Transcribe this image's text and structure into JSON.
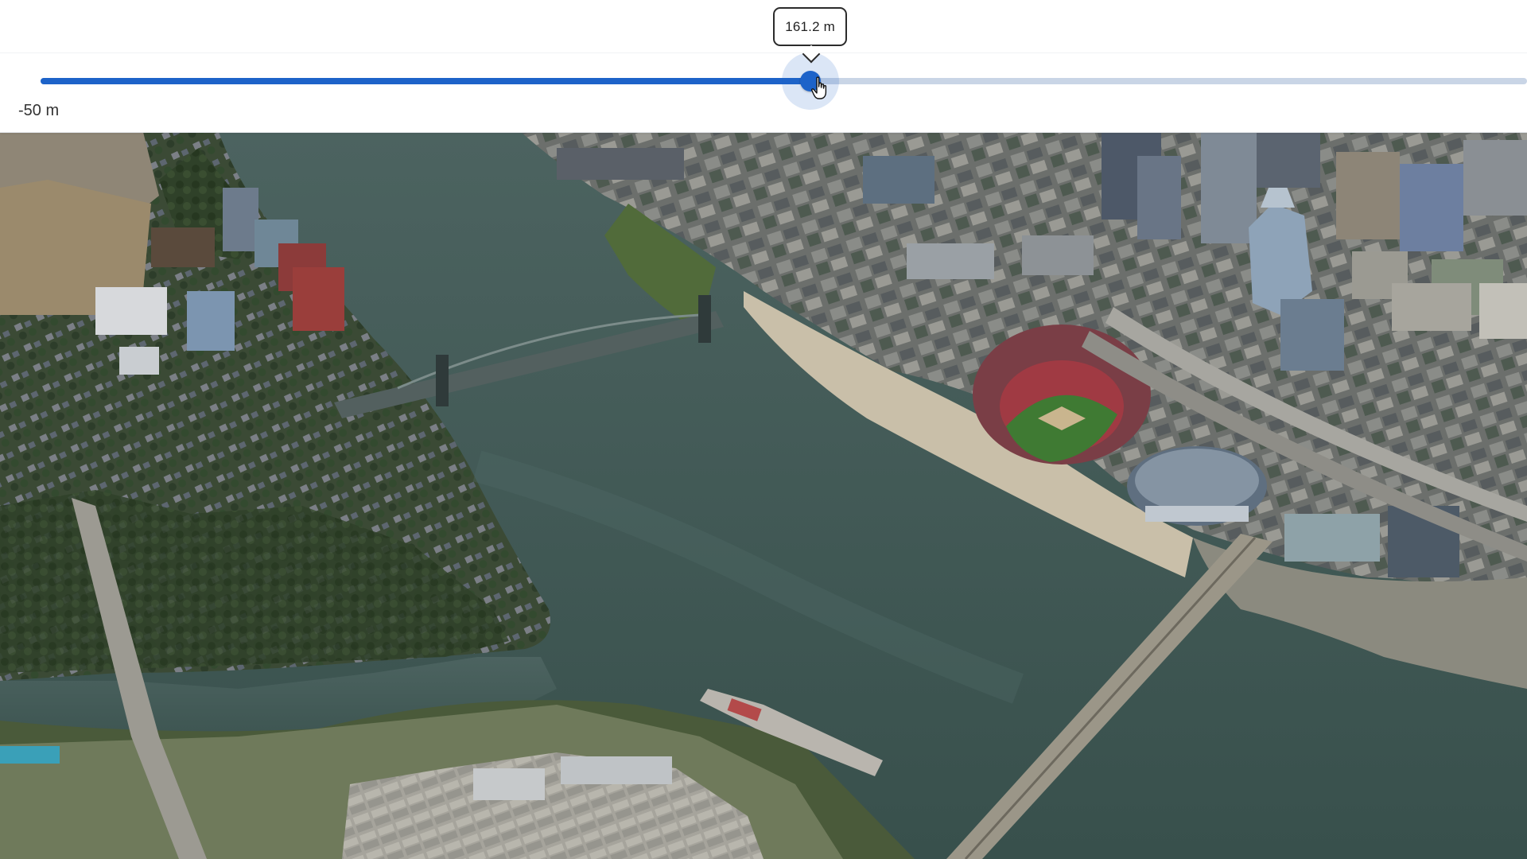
{
  "slider": {
    "min_label": "-50 m",
    "value_label": "161.2 m",
    "fill_fraction": 0.518
  },
  "colors": {
    "accent": "#1d63c9",
    "track_inactive": "#c9d5e6",
    "river": "#3f5650"
  },
  "map": {
    "kind": "3D aerial imagery",
    "icons": [
      "hand-pointer-cursor-icon"
    ]
  }
}
